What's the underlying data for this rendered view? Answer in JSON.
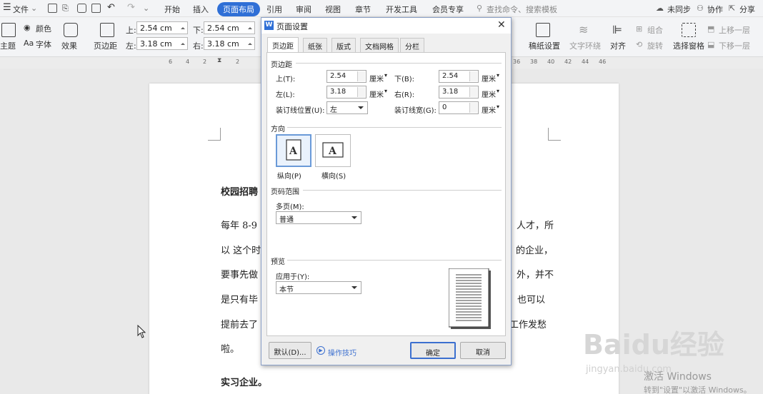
{
  "menubar": {
    "file": "文件",
    "tabs": [
      "开始",
      "插入",
      "页面布局",
      "引用",
      "审阅",
      "视图",
      "章节",
      "开发工具",
      "会员专享"
    ],
    "active_tab": "页面布局",
    "search": "查找命令、搜索模板",
    "sync": "未同步",
    "collab": "协作",
    "share": "分享"
  },
  "ribbon": {
    "theme": "主题",
    "colors": "颜色",
    "font": "字体",
    "effects": "效果",
    "margins": "页边距",
    "top_label": "上:",
    "top_value": "2.54 cm",
    "bottom_label": "下:",
    "bottom_value": "2.54 cm",
    "left_label": "左:",
    "left_value": "3.18 cm",
    "right_label": "右:",
    "right_value": "3.18 cm",
    "manuscript": "稿纸设置",
    "text_wrap": "文字环绕",
    "align": "对齐",
    "group": "组合",
    "rotate": "旋转",
    "selection_pane": "选择窗格",
    "bring_forward": "上移一层",
    "send_backward": "下移一层"
  },
  "ruler": {
    "left_ticks": [
      "6",
      "4",
      "2",
      "2"
    ],
    "right_ticks": [
      "36",
      "38",
      "40",
      "42",
      "44",
      "46"
    ]
  },
  "document": {
    "heading1": "校园招聘",
    "p1_left": "每年 8-9",
    "p1_right": "人才，所",
    "p2_left": "以 这个时",
    "p2_right": "的企业，",
    "p3_left": "要事先做",
    "p3_right": "外，并不",
    "p4_left": "是只有毕",
    "p4_right": "，也可以",
    "p5_left": "提前去了",
    "p5_right": "工作发愁",
    "p6": "啦。",
    "heading2": "实习企业。"
  },
  "dialog": {
    "title": "页面设置",
    "tabs": [
      "页边距",
      "纸张",
      "版式",
      "文档网格",
      "分栏"
    ],
    "active_tab": "页边距",
    "margins_section": "页边距",
    "top_label": "上(T):",
    "top_value": "2.54",
    "bottom_label": "下(B):",
    "bottom_value": "2.54",
    "left_label": "左(L):",
    "left_value": "3.18",
    "right_label": "右(R):",
    "right_value": "3.18",
    "unit": "厘米",
    "gutter_pos_label": "装订线位置(U):",
    "gutter_pos_value": "左",
    "gutter_width_label": "装订线宽(G):",
    "gutter_width_value": "0",
    "orientation_section": "方向",
    "portrait": "纵向(P)",
    "landscape": "横向(S)",
    "page_range_section": "页码范围",
    "multiple_pages_label": "多页(M):",
    "multiple_pages_value": "普通",
    "preview_section": "预览",
    "apply_to_label": "应用于(Y):",
    "apply_to_value": "本节",
    "default_button": "默认(D)...",
    "tips_link": "操作技巧",
    "ok_button": "确定",
    "cancel_button": "取消"
  },
  "watermark": {
    "activate_title": "激活 Windows",
    "activate_sub": "转到\"设置\"以激活 Windows。",
    "baidu": "Baidu经验",
    "baidu_url": "jingyan.baidu.com"
  }
}
